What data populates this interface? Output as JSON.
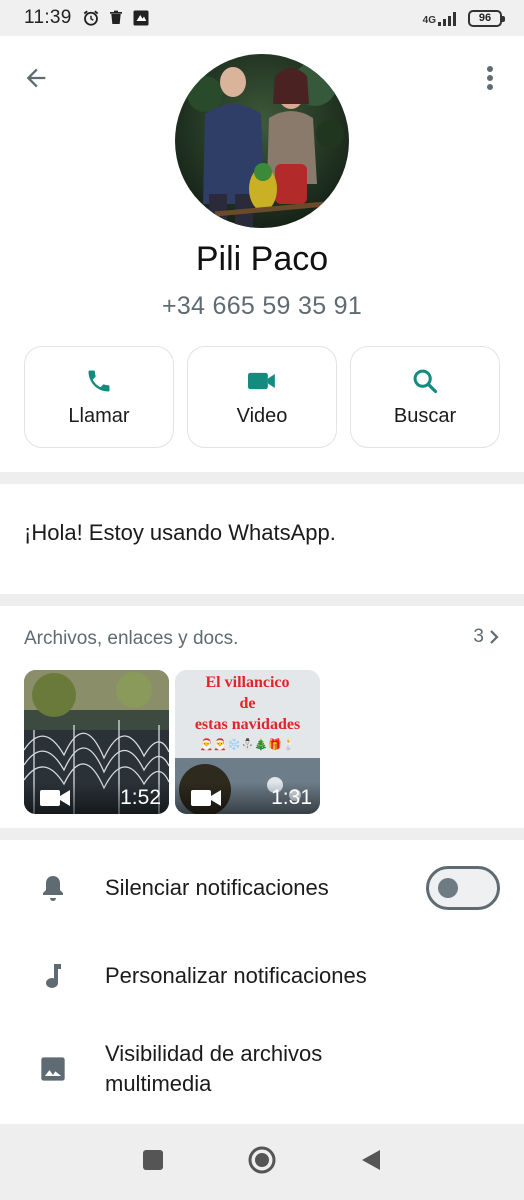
{
  "status_bar": {
    "time": "11:39",
    "network": "4G",
    "battery": "96"
  },
  "contact": {
    "name": "Pili Paco",
    "phone": "+34 665 59 35 91"
  },
  "actions": [
    {
      "label": "Llamar",
      "icon": "phone-icon"
    },
    {
      "label": "Video",
      "icon": "video-icon"
    },
    {
      "label": "Buscar",
      "icon": "search-icon"
    }
  ],
  "about": {
    "text": "¡Hola! Estoy usando WhatsApp."
  },
  "media": {
    "title": "Archivos, enlaces y docs.",
    "count": "3",
    "items": [
      {
        "duration": "1:52"
      },
      {
        "duration": "1:31",
        "overlay_line1": "El villancico",
        "overlay_line2": "de",
        "overlay_line3": "estas navidades",
        "emoji": "🎅🎅❄️⛄🎄🎁🕯️"
      }
    ]
  },
  "settings": [
    {
      "label": "Silenciar notificaciones",
      "icon": "bell-icon",
      "toggle": false
    },
    {
      "label": "Personalizar notificaciones",
      "icon": "music-note-icon"
    },
    {
      "label": "Visibilidad de archivos multimedia",
      "icon": "image-icon"
    }
  ],
  "colors": {
    "accent": "#128c7e",
    "icon_grey": "#5f6b72"
  }
}
